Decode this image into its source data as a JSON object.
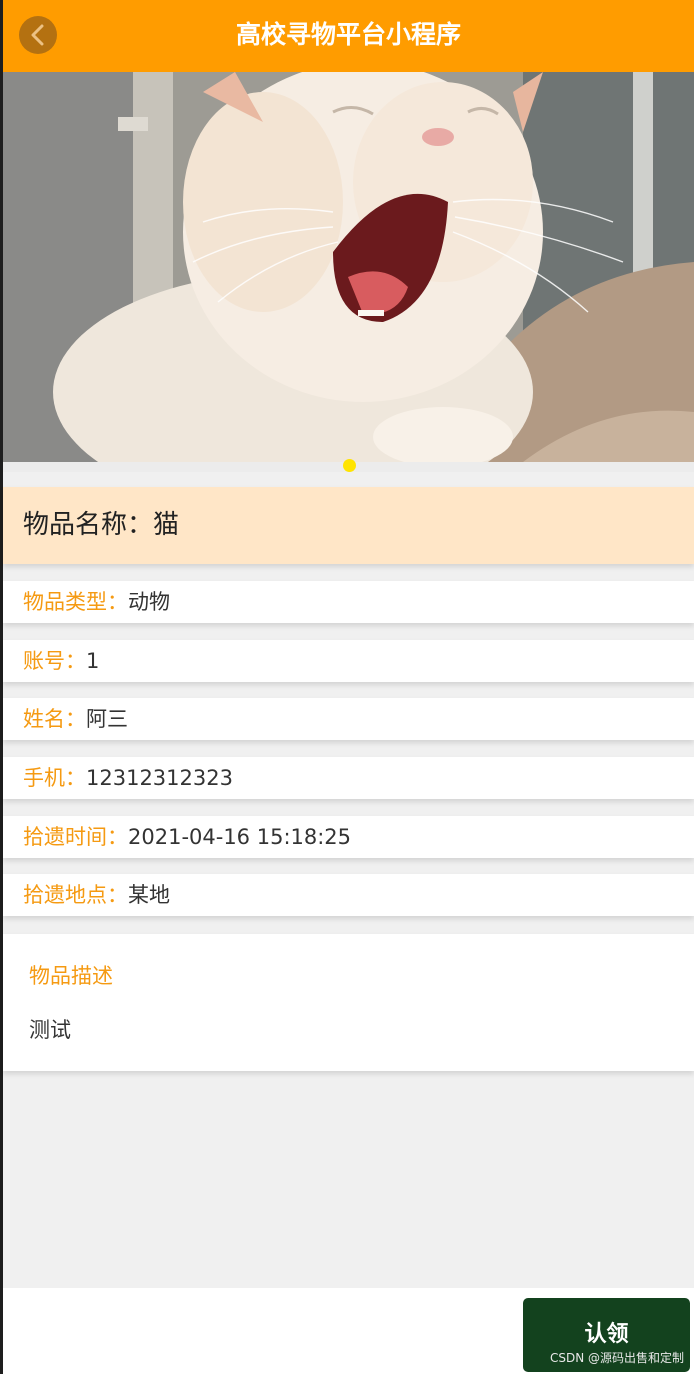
{
  "header": {
    "title": "高校寻物平台小程序"
  },
  "item": {
    "name_label": "物品名称：",
    "name_value": "猫",
    "fields": [
      {
        "label": "物品类型：",
        "value": "动物"
      },
      {
        "label": "账号：",
        "value": "1"
      },
      {
        "label": "姓名：",
        "value": "阿三"
      },
      {
        "label": "手机：",
        "value": "12312312323"
      },
      {
        "label": "拾遗时间：",
        "value": "2021-04-16 15:18:25"
      },
      {
        "label": "拾遗地点：",
        "value": "某地"
      }
    ],
    "description_label": "物品描述",
    "description_value": "测试"
  },
  "actions": {
    "claim_label": "认领"
  },
  "watermark": "CSDN @源码出售和定制",
  "icons": {
    "back": "chevron-left-icon"
  },
  "colors": {
    "header": "#ff9c00",
    "label": "#f59a12",
    "name_bar": "#ffe6c7",
    "claim_button": "#13421e",
    "indicator_dot": "#ffe400"
  }
}
